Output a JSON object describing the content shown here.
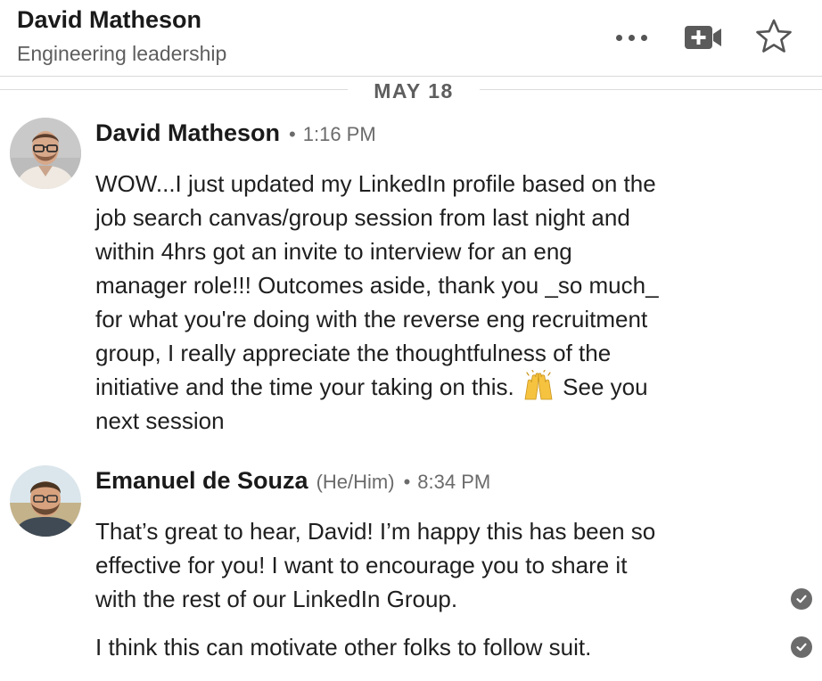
{
  "header": {
    "name": "David Matheson",
    "subtitle": "Engineering leadership",
    "icons": [
      "more-icon",
      "video-call-icon",
      "star-icon"
    ]
  },
  "date_divider": "MAY 18",
  "messages": [
    {
      "sender": "David Matheson",
      "pronouns": "",
      "separator": "•",
      "time": "1:16 PM",
      "lines": [
        "WOW...I just updated my LinkedIn profile based on the",
        "job search canvas/group session from last night and",
        "within 4hrs got an invite to interview for an eng",
        "manager role!!! Outcomes aside, thank you _so much_",
        "for what you're doing with the reverse eng recruitment",
        "group, I really appreciate the thoughtfulness of the",
        "initiative and the time your taking on this.",
        "See you",
        "next session"
      ],
      "emoji": "raising-hands-emoji"
    },
    {
      "sender": "Emanuel de Souza",
      "pronouns": "(He/Him)",
      "separator": "•",
      "time": "8:34 PM",
      "lines": [
        "That’s great to hear, David! I’m happy this has been so",
        "effective for you! I want to encourage you to share it",
        "with the rest of our LinkedIn Group.",
        "I think this can motivate other folks to follow suit."
      ],
      "status_icon": "read-receipt-check-icon"
    }
  ],
  "colors": {
    "text": "#1d1d1d",
    "muted": "#6b6b6b",
    "divider": "#dcdcdc",
    "icon": "#555555"
  }
}
